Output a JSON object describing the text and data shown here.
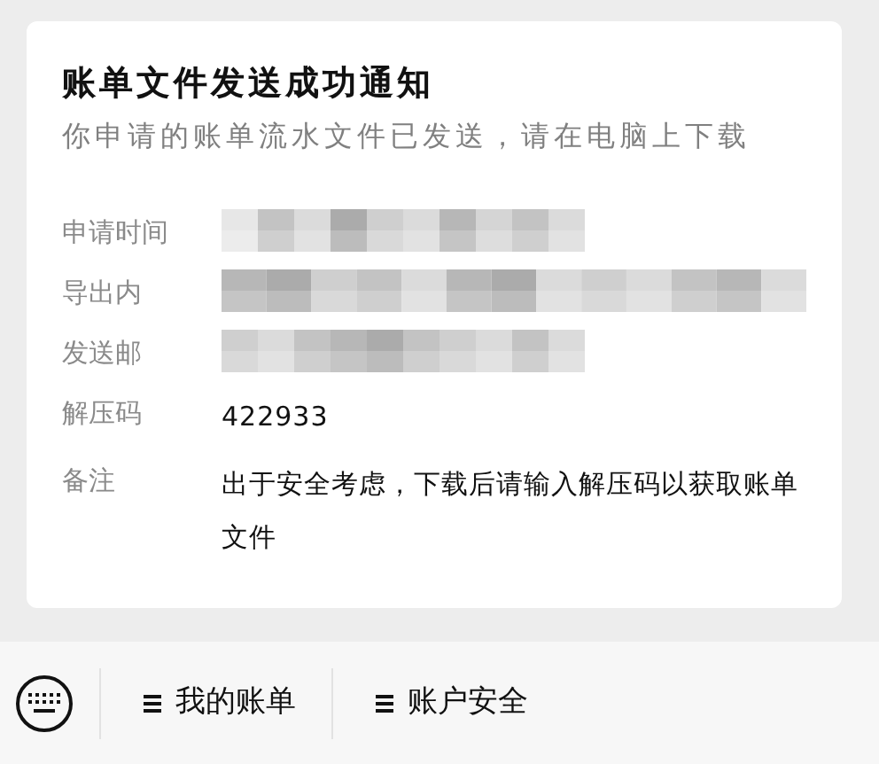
{
  "card": {
    "title": "账单文件发送成功通知",
    "subtitle": "你申请的账单流水文件已发送，请在电脑上下载",
    "fields": [
      {
        "label": "申请时间",
        "redacted": true
      },
      {
        "label": "导出内",
        "redacted": true
      },
      {
        "label": "发送邮",
        "redacted": true
      },
      {
        "label": "解压码",
        "value": "422933"
      },
      {
        "label": "备注",
        "value": "出于安全考虑，下载后请输入解压码以获取账单文件"
      }
    ]
  },
  "menu_bar": {
    "items": [
      {
        "label": "我的账单"
      },
      {
        "label": "账户安全"
      }
    ]
  }
}
